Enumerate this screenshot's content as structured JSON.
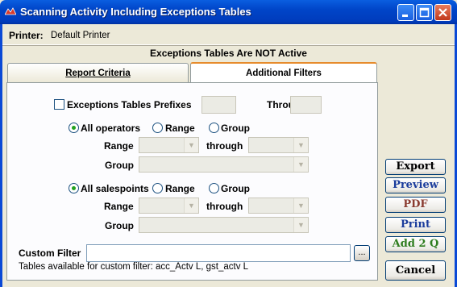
{
  "window": {
    "title": "Scanning Activity Including Exceptions Tables"
  },
  "printer": {
    "label": "Printer:",
    "value": "Default Printer"
  },
  "status": "Exceptions Tables Are  NOT Active",
  "tabs": [
    {
      "label": "Report Criteria"
    },
    {
      "label": "Additional Filters"
    }
  ],
  "filters": {
    "exceptions_prefixes_label": "Exceptions Tables Prefixes",
    "through_label": "Through",
    "operators": {
      "all": "All operators",
      "range": "Range",
      "group": "Group",
      "range_label": "Range",
      "through_label": "through",
      "group_label": "Group"
    },
    "salespoints": {
      "all": "All salespoints",
      "range": "Range",
      "group": "Group",
      "range_label": "Range",
      "through_label": "through",
      "group_label": "Group"
    },
    "custom_filter_label": "Custom Filter",
    "custom_filter_value": "",
    "dots_label": "...",
    "tables_note": "Tables available for custom filter: acc_Actv L, gst_actv L"
  },
  "buttons": [
    {
      "label": "Export",
      "color": "#000000"
    },
    {
      "label": "Preview",
      "color": "#1a3c9c"
    },
    {
      "label": "PDF",
      "color": "#8a3b30"
    },
    {
      "label": "Print",
      "color": "#1a3c9c"
    },
    {
      "label": "Add 2 Q",
      "color": "#2e7d1f"
    },
    {
      "label": "Cancel",
      "color": "#000000"
    }
  ]
}
